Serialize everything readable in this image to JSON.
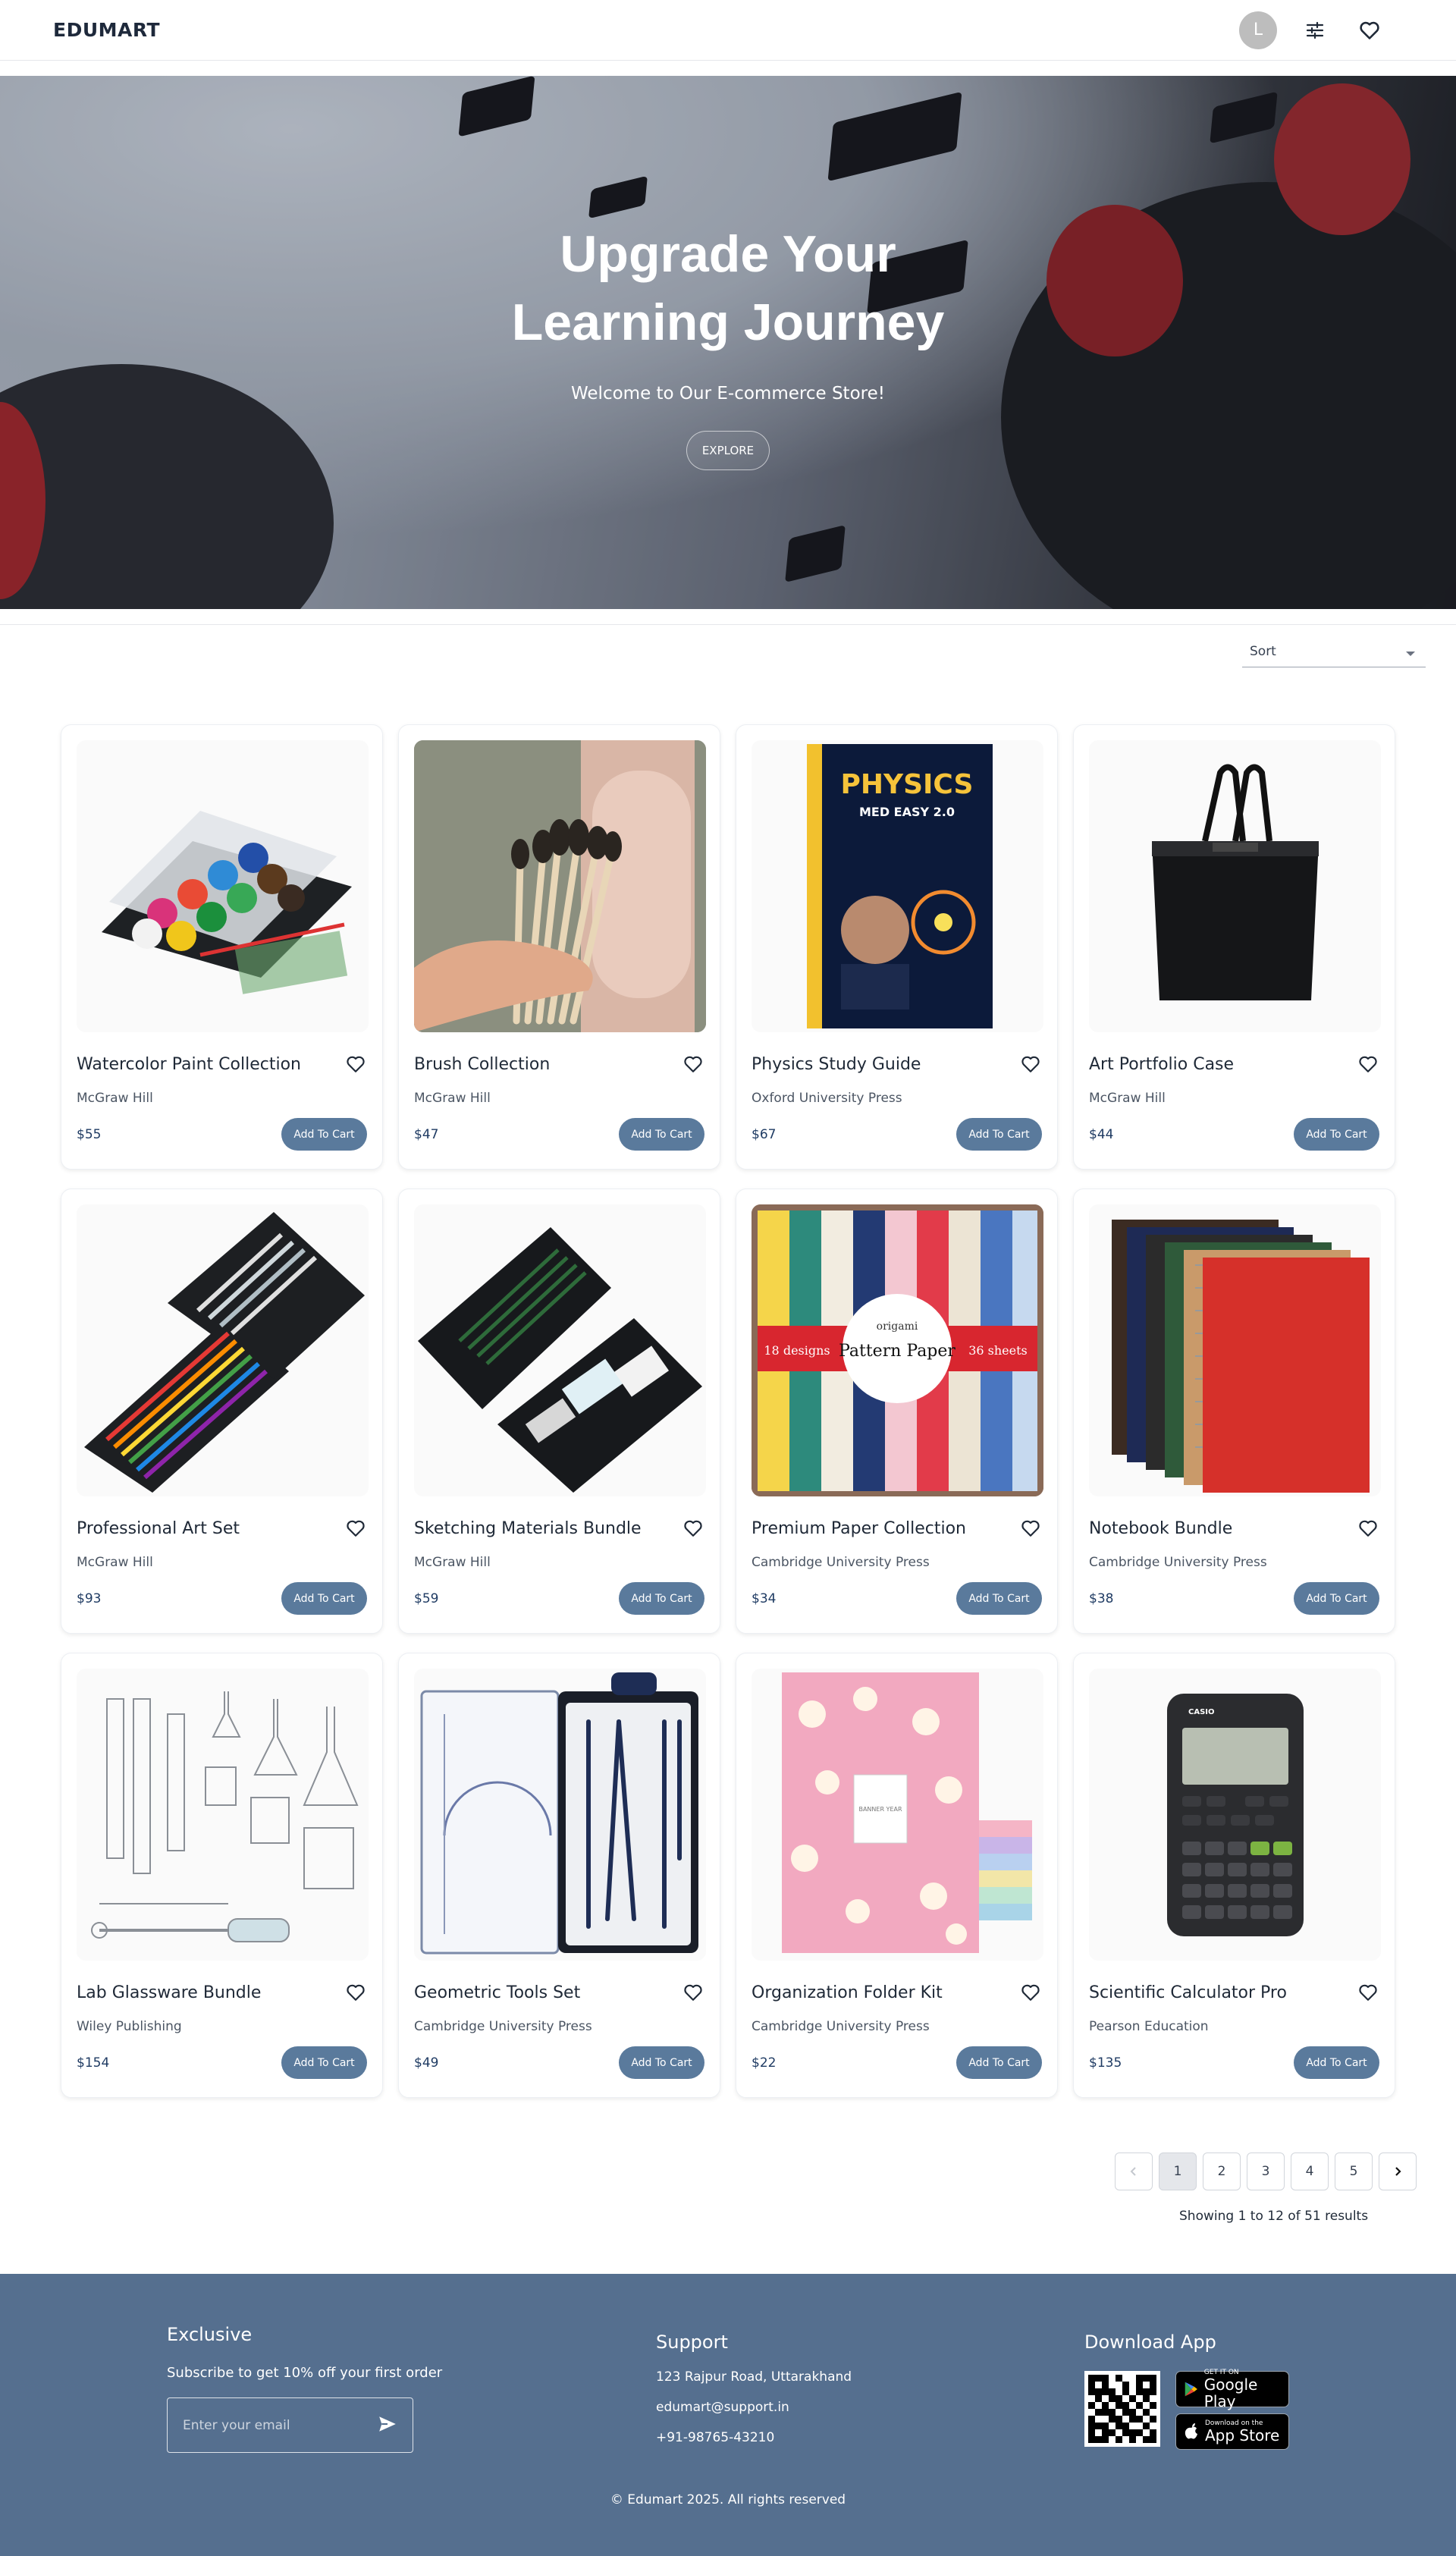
{
  "header": {
    "brand": "EDUMART",
    "avatar_initial": "L"
  },
  "hero": {
    "title_line1": "Upgrade Your",
    "title_line2": "Learning Journey",
    "subtitle": "Welcome to Our E-commerce Store!",
    "cta": "EXPLORE"
  },
  "sort": {
    "label": "Sort"
  },
  "products": [
    {
      "title": "Watercolor Paint Collection",
      "publisher": "McGraw Hill",
      "price": "$55",
      "button": "Add To Cart"
    },
    {
      "title": "Brush Collection",
      "publisher": "McGraw Hill",
      "price": "$47",
      "button": "Add To Cart"
    },
    {
      "title": "Physics Study Guide",
      "publisher": "Oxford University Press",
      "price": "$67",
      "button": "Add To Cart"
    },
    {
      "title": "Art Portfolio Case",
      "publisher": "McGraw Hill",
      "price": "$44",
      "button": "Add To Cart"
    },
    {
      "title": "Professional Art Set",
      "publisher": "McGraw Hill",
      "price": "$93",
      "button": "Add To Cart"
    },
    {
      "title": "Sketching Materials Bundle",
      "publisher": "McGraw Hill",
      "price": "$59",
      "button": "Add To Cart"
    },
    {
      "title": "Premium Paper Collection",
      "publisher": "Cambridge University Press",
      "price": "$34",
      "button": "Add To Cart"
    },
    {
      "title": "Notebook Bundle",
      "publisher": "Cambridge University Press",
      "price": "$38",
      "button": "Add To Cart"
    },
    {
      "title": "Lab Glassware Bundle",
      "publisher": "Wiley Publishing",
      "price": "$154",
      "button": "Add To Cart"
    },
    {
      "title": "Geometric Tools Set",
      "publisher": "Cambridge University Press",
      "price": "$49",
      "button": "Add To Cart"
    },
    {
      "title": "Organization Folder Kit",
      "publisher": "Cambridge University Press",
      "price": "$22",
      "button": "Add To Cart"
    },
    {
      "title": "Scientific Calculator Pro",
      "publisher": "Pearson Education",
      "price": "$135",
      "button": "Add To Cart"
    }
  ],
  "product_images": {
    "book_title": "PHYSICS",
    "book_subtitle": "MED EASY 2.0",
    "paper_left": "18 designs",
    "paper_center_small": "origami",
    "paper_center": "Pattern Paper",
    "paper_right": "36 sheets",
    "calc_brand": "CASIO",
    "folder_label": "BANNER YEAR"
  },
  "pagination": {
    "pages": [
      "1",
      "2",
      "3",
      "4",
      "5"
    ],
    "current_page": "1",
    "results": "Showing 1 to 12 of 51 results"
  },
  "footer": {
    "exclusive_heading": "Exclusive",
    "exclusive_sub": "Subscribe to get 10% off your first order",
    "email_placeholder": "Enter your email",
    "support_heading": "Support",
    "address": "123 Rajpur Road, Uttarakhand",
    "email": "edumart@support.in",
    "phone": "+91-98765-43210",
    "download_heading": "Download App",
    "google_small": "GET IT ON",
    "google_big": "Google Play",
    "apple_small": "Download on the",
    "apple_big": "App Store",
    "copyright": "© Edumart 2025. All rights reserved"
  },
  "colors": {
    "primary": "#556f8f",
    "button": "#5a7a9c",
    "price": "#1f3b63"
  },
  "icons": [
    "user-avatar",
    "filter-sliders-icon",
    "heart-icon",
    "chevron-left-icon",
    "chevron-right-icon",
    "send-icon",
    "qr-code",
    "google-play-icon",
    "apple-icon"
  ]
}
